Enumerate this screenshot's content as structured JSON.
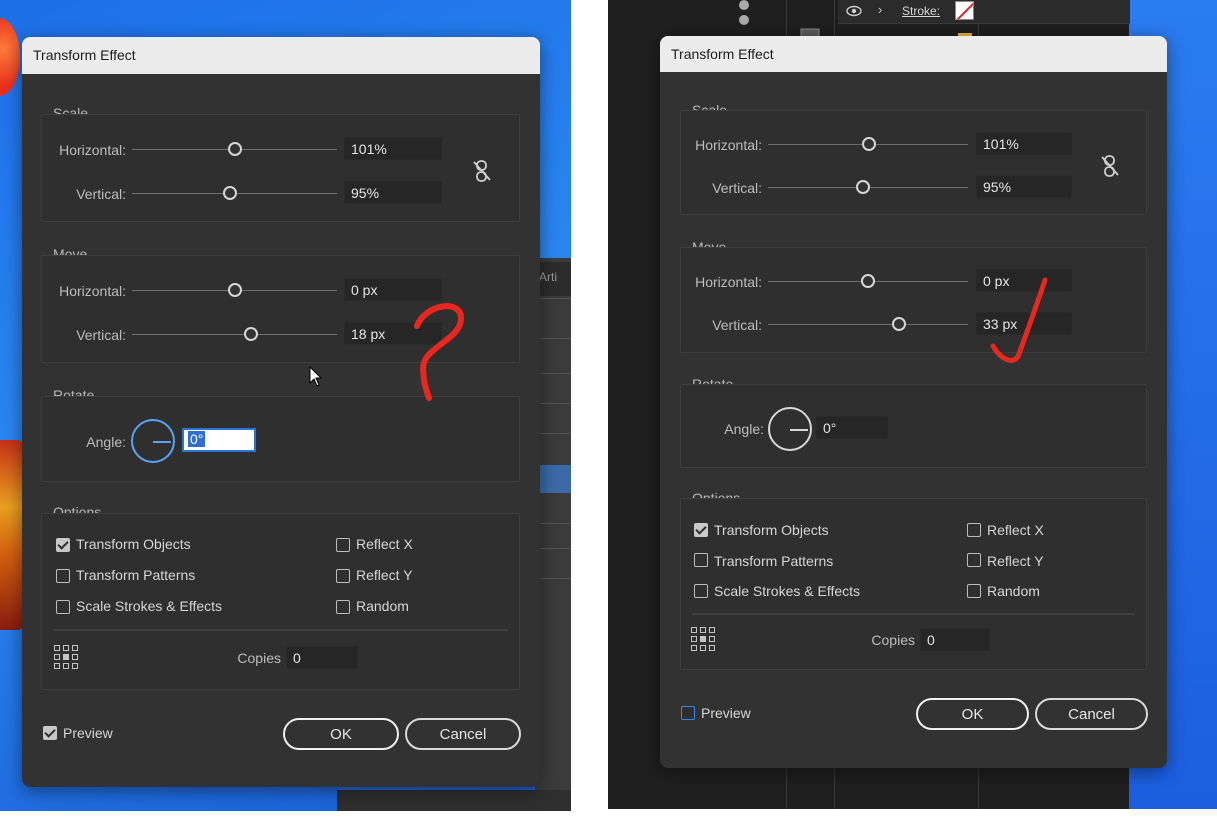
{
  "left_panel": {
    "dialog": {
      "title": "Transform Effect",
      "scale": {
        "group_label": "Scale",
        "horizontal_label": "Horizontal:",
        "horizontal_value": "101%",
        "vertical_label": "Vertical:",
        "vertical_value": "95%"
      },
      "move": {
        "group_label": "Move",
        "horizontal_label": "Horizontal:",
        "horizontal_value": "0 px",
        "vertical_label": "Vertical:",
        "vertical_value": "18 px"
      },
      "rotate": {
        "group_label": "Rotate",
        "angle_label": "Angle:",
        "angle_value": "0°"
      },
      "options": {
        "group_label": "Options",
        "transform_objects": "Transform Objects",
        "transform_patterns": "Transform Patterns",
        "scale_strokes": "Scale Strokes & Effects",
        "reflect_x": "Reflect X",
        "reflect_y": "Reflect Y",
        "random": "Random",
        "copies_label": "Copies",
        "copies_value": "0"
      },
      "preview_label": "Preview",
      "ok_label": "OK",
      "cancel_label": "Cancel"
    },
    "background_panel_label": "Arti"
  },
  "right_panel": {
    "layers_row": {
      "stroke_label": "Stroke:"
    },
    "dialog": {
      "title": "Transform Effect",
      "scale": {
        "group_label": "Scale",
        "horizontal_label": "Horizontal:",
        "horizontal_value": "101%",
        "vertical_label": "Vertical:",
        "vertical_value": "95%"
      },
      "move": {
        "group_label": "Move",
        "horizontal_label": "Horizontal:",
        "horizontal_value": "0 px",
        "vertical_label": "Vertical:",
        "vertical_value": "33 px"
      },
      "rotate": {
        "group_label": "Rotate",
        "angle_label": "Angle:",
        "angle_value": "0°"
      },
      "options": {
        "group_label": "Options",
        "transform_objects": "Transform Objects",
        "transform_patterns": "Transform Patterns",
        "scale_strokes": "Scale Strokes & Effects",
        "reflect_x": "Reflect X",
        "reflect_y": "Reflect Y",
        "random": "Random",
        "copies_label": "Copies",
        "copies_value": "0"
      },
      "preview_label": "Preview",
      "ok_label": "OK",
      "cancel_label": "Cancel"
    }
  },
  "colors": {
    "dialog_bg": "#323232",
    "titlebar_bg": "#ececec",
    "annotation_red": "#e8281e",
    "focus_blue": "#2b74d8"
  }
}
